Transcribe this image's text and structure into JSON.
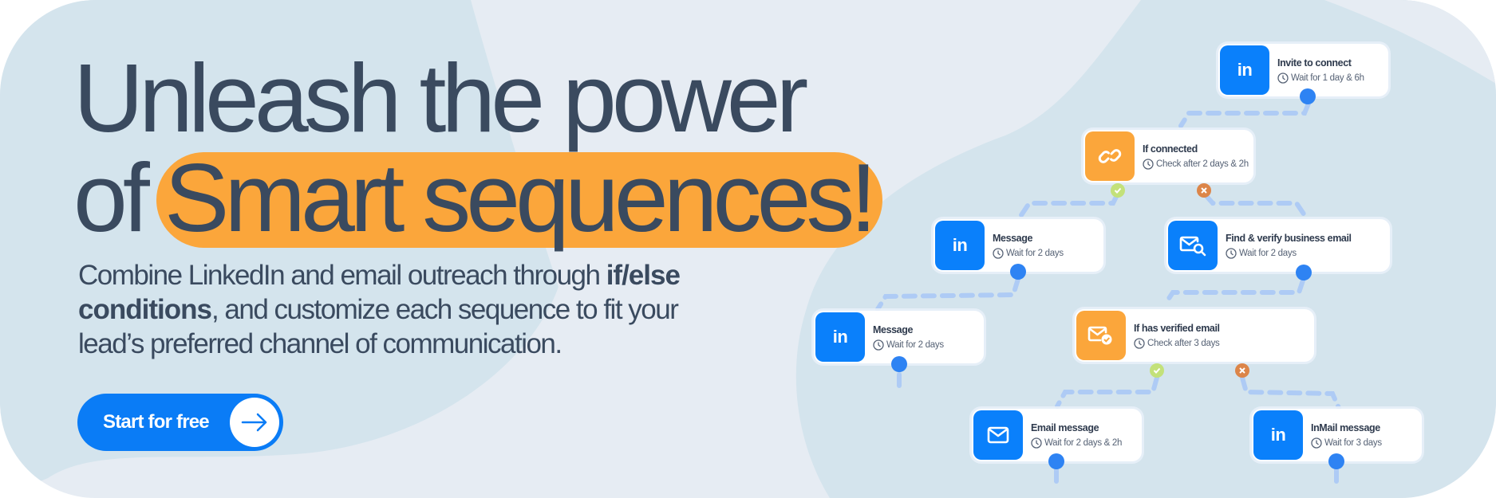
{
  "headline": {
    "line1": "Unleash the power",
    "line2_prefix": "of",
    "line2_highlight": "Smart sequences!"
  },
  "subtext": {
    "part1": "Combine LinkedIn and email outreach through ",
    "bold1": "if/else",
    "bold2": "conditions",
    "part2": ", and customize each sequence to fit your lead’s preferred channel of communication."
  },
  "cta": {
    "label": "Start for free",
    "icon": "arrow-right-icon"
  },
  "colors": {
    "background": "#e6ecf3",
    "blob": "#d4e4ed",
    "text": "#3a4a5f",
    "highlight": "#fba63b",
    "primary": "#0a7cf6",
    "tile_blue": "#0a80fb",
    "tile_orange": "#fba63b",
    "connector": "#aecbf5",
    "node_dot": "#2e83f3",
    "yes_badge": "#c3e17a",
    "no_badge": "#dc8549"
  },
  "sequence": {
    "steps": [
      {
        "id": "invite",
        "icon": "linkedin-icon",
        "tile": "blue",
        "title": "Invite to connect",
        "subtitle": "Wait for 1 day & 6h"
      },
      {
        "id": "if-connected",
        "icon": "link-icon",
        "tile": "orange",
        "title": "If connected",
        "subtitle": "Check after 2 days & 2h"
      },
      {
        "id": "message-1",
        "icon": "linkedin-icon",
        "tile": "blue",
        "title": "Message",
        "subtitle": "Wait for 2 days"
      },
      {
        "id": "find-email",
        "icon": "email-search-icon",
        "tile": "blue",
        "title": "Find & verify business email",
        "subtitle": "Wait for 2 days"
      },
      {
        "id": "message-2",
        "icon": "linkedin-icon",
        "tile": "blue",
        "title": "Message",
        "subtitle": "Wait for 2 days"
      },
      {
        "id": "if-verified",
        "icon": "email-verified-icon",
        "tile": "orange",
        "title": "If has verified email",
        "subtitle": "Check after  3 days"
      },
      {
        "id": "email-message",
        "icon": "envelope-icon",
        "tile": "blue",
        "title": "Email message",
        "subtitle": "Wait for 2 days & 2h"
      },
      {
        "id": "inmail",
        "icon": "linkedin-icon",
        "tile": "blue",
        "title": "InMail message",
        "subtitle": "Wait for 3 days"
      }
    ],
    "linkedin_glyph": "in"
  }
}
